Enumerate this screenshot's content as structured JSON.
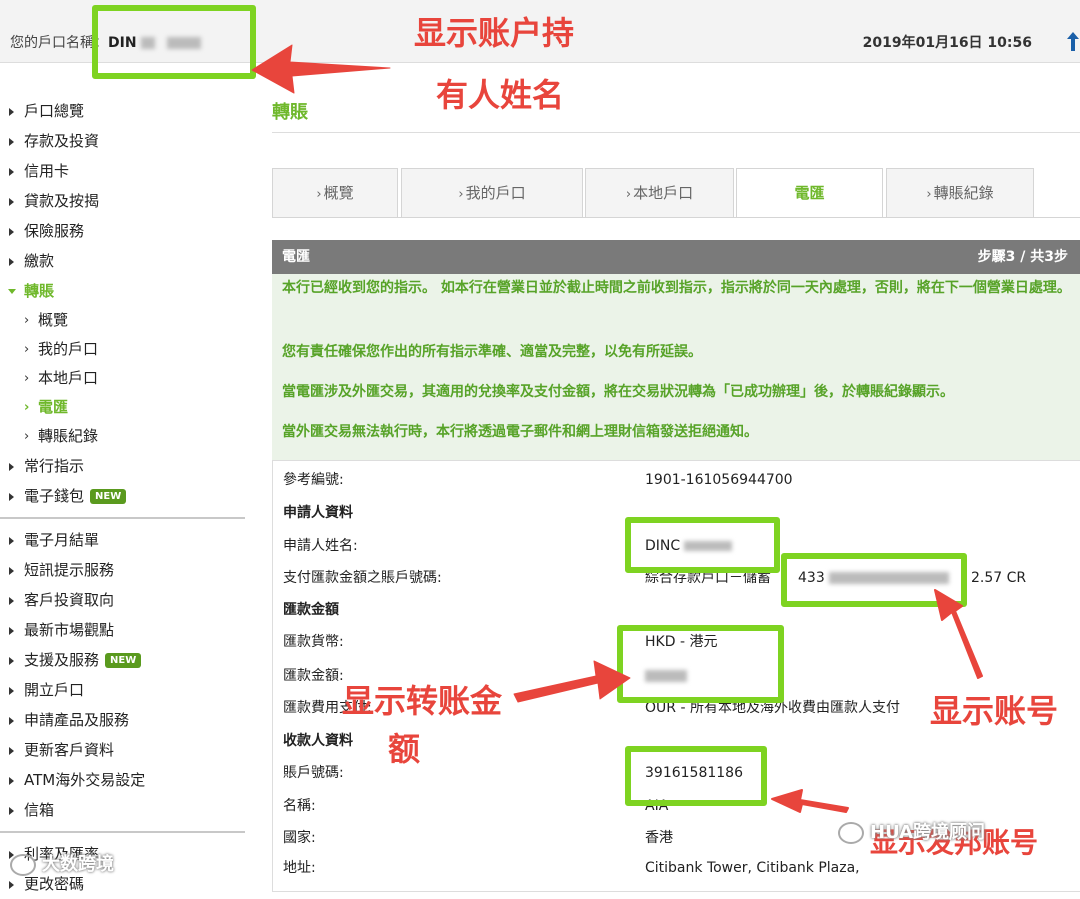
{
  "header": {
    "account_label": "您的戶口名稱：",
    "account_name": "DIN",
    "datetime": "2019年01月16日 10:56"
  },
  "sidebar": {
    "items": [
      {
        "label": "戶口總覽"
      },
      {
        "label": "存款及投資"
      },
      {
        "label": "信用卡"
      },
      {
        "label": "貸款及按揭"
      },
      {
        "label": "保險服務"
      },
      {
        "label": "繳款"
      },
      {
        "label": "轉賬"
      }
    ],
    "subitems": [
      {
        "label": "概覽"
      },
      {
        "label": "我的戶口"
      },
      {
        "label": "本地戶口"
      },
      {
        "label": "電匯"
      },
      {
        "label": "轉賬紀錄"
      }
    ],
    "items2": [
      {
        "label": "常行指示"
      },
      {
        "label": "電子錢包"
      }
    ],
    "items3": [
      {
        "label": "電子月結單"
      },
      {
        "label": "短訊提示服務"
      },
      {
        "label": "客戶投資取向"
      },
      {
        "label": "最新市場觀點"
      },
      {
        "label": "支援及服務"
      },
      {
        "label": "開立戶口"
      },
      {
        "label": "申請產品及服務"
      },
      {
        "label": "更新客戶資料"
      },
      {
        "label": "ATM海外交易設定"
      },
      {
        "label": "信箱"
      }
    ],
    "items4": [
      {
        "label": "利率及匯率"
      },
      {
        "label": "更改密碼"
      }
    ],
    "new_badge": "NEW"
  },
  "main": {
    "title": "轉賬",
    "tabs": [
      {
        "label": "概覽"
      },
      {
        "label": "我的戶口"
      },
      {
        "label": "本地戶口"
      },
      {
        "label": "電匯"
      },
      {
        "label": "轉賬紀錄"
      }
    ],
    "panel_title": "電匯",
    "step": "步驟3 / 共3步",
    "notices": [
      "本行已經收到您的指示。 如本行在營業日並於截止時間之前收到指示，指示將於同一天內處理，否則，將在下一個營業日處理。",
      "您有責任確保您作出的所有指示準確、適當及完整，以免有所延誤。",
      "當電匯涉及外匯交易，其適用的兌換率及支付金額，將在交易狀況轉為「已成功辦理」後，於轉賬紀錄顯示。",
      "當外匯交易無法執行時，本行將透過電子郵件和網上理財信箱發送拒絕通知。"
    ],
    "details": {
      "ref_label": "參考編號:",
      "ref_value": "1901-161056944700",
      "applicant_section": "申請人資料",
      "applicant_name_label": "申請人姓名:",
      "applicant_name_value": "DINC",
      "pay_account_label": "支付匯款金額之賬戶號碼:",
      "pay_account_value": "綜合存款戶口－儲蓄",
      "pay_account_number": "433",
      "pay_account_balance": "2.57 CR",
      "amount_section": "匯款金額",
      "currency_label": "匯款貨幣:",
      "currency_value": "HKD - 港元",
      "amount_label": "匯款金額:",
      "charges_label": "匯款費用支付:",
      "charges_value": "OUR - 所有本地及海外收費由匯款人支付",
      "payee_section": "收款人資料",
      "payee_account_label": "賬戶號碼:",
      "payee_account_value": "39161581186",
      "payee_name_label": "名稱:",
      "payee_name_value": "AIA",
      "payee_country_label": "國家:",
      "payee_country_value": "香港",
      "payee_address_label": "地址:",
      "payee_address_value": "Citibank Tower, Citibank Plaza,"
    }
  },
  "annotations": {
    "holder_name_line1": "显示账户持",
    "holder_name_line2": "有人姓名",
    "amount_line1": "显示转账金",
    "amount_line2": "额",
    "account_number": "显示账号",
    "payee_account": "显示发邦账号"
  },
  "watermarks": {
    "left": "大数跨境",
    "right": "HUA跨境顾问"
  },
  "colors": {
    "brand_green": "#6fb82b",
    "highlight_box": "#7ed321",
    "annotation_red": "#e8453c",
    "panel_header": "#7a7a7a"
  }
}
